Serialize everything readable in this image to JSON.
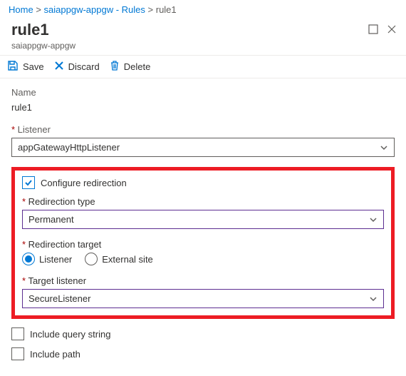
{
  "breadcrumb": {
    "home": "Home",
    "rules": "saiappgw-appgw - Rules",
    "current": "rule1"
  },
  "header": {
    "title": "rule1",
    "subtitle": "saiappgw-appgw"
  },
  "toolbar": {
    "save": "Save",
    "discard": "Discard",
    "delete": "Delete"
  },
  "fields": {
    "name_label": "Name",
    "name_value": "rule1",
    "listener_label": "Listener",
    "listener_value": "appGatewayHttpListener",
    "configure_redirect": "Configure redirection",
    "redirection_type_label": "Redirection type",
    "redirection_type_value": "Permanent",
    "redirection_target_label": "Redirection target",
    "target_listener_radio": "Listener",
    "target_external_radio": "External site",
    "target_listener_label": "Target listener",
    "target_listener_value": "SecureListener",
    "include_query": "Include query string",
    "include_path": "Include path"
  }
}
